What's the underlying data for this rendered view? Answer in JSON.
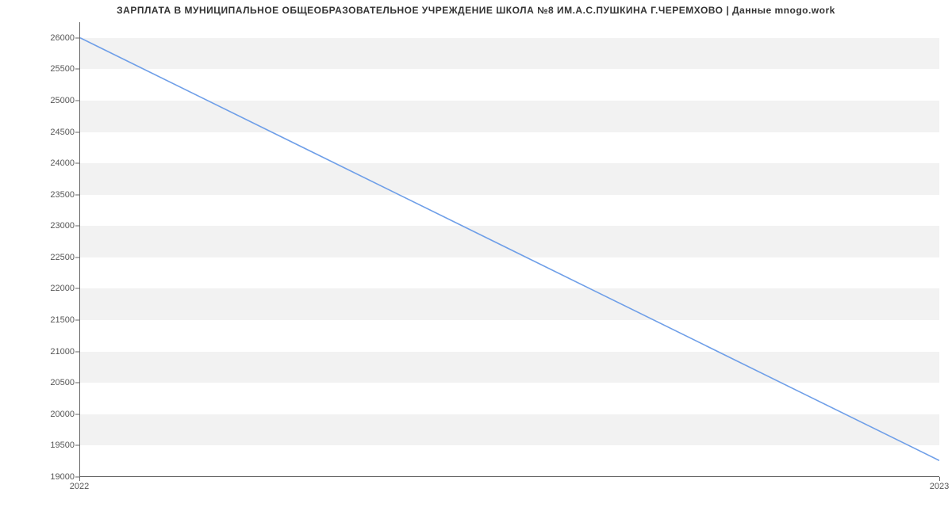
{
  "chart_data": {
    "type": "line",
    "title": "ЗАРПЛАТА В МУНИЦИПАЛЬНОЕ ОБЩЕОБРАЗОВАТЕЛЬНОЕ УЧРЕЖДЕНИЕ ШКОЛА №8 ИМ.А.С.ПУШКИНА Г.ЧЕРЕМХОВО | Данные mnogo.work",
    "x": [
      2022,
      2023
    ],
    "values": [
      26000,
      19250
    ],
    "x_ticks": [
      2022,
      2023
    ],
    "y_ticks": [
      19000,
      19500,
      20000,
      20500,
      21000,
      21500,
      22000,
      22500,
      23000,
      23500,
      24000,
      24500,
      25000,
      25500,
      26000
    ],
    "xlim": [
      2022,
      2023
    ],
    "ylim": [
      19000,
      26250
    ],
    "xlabel": "",
    "ylabel": "",
    "grid": "banded"
  }
}
